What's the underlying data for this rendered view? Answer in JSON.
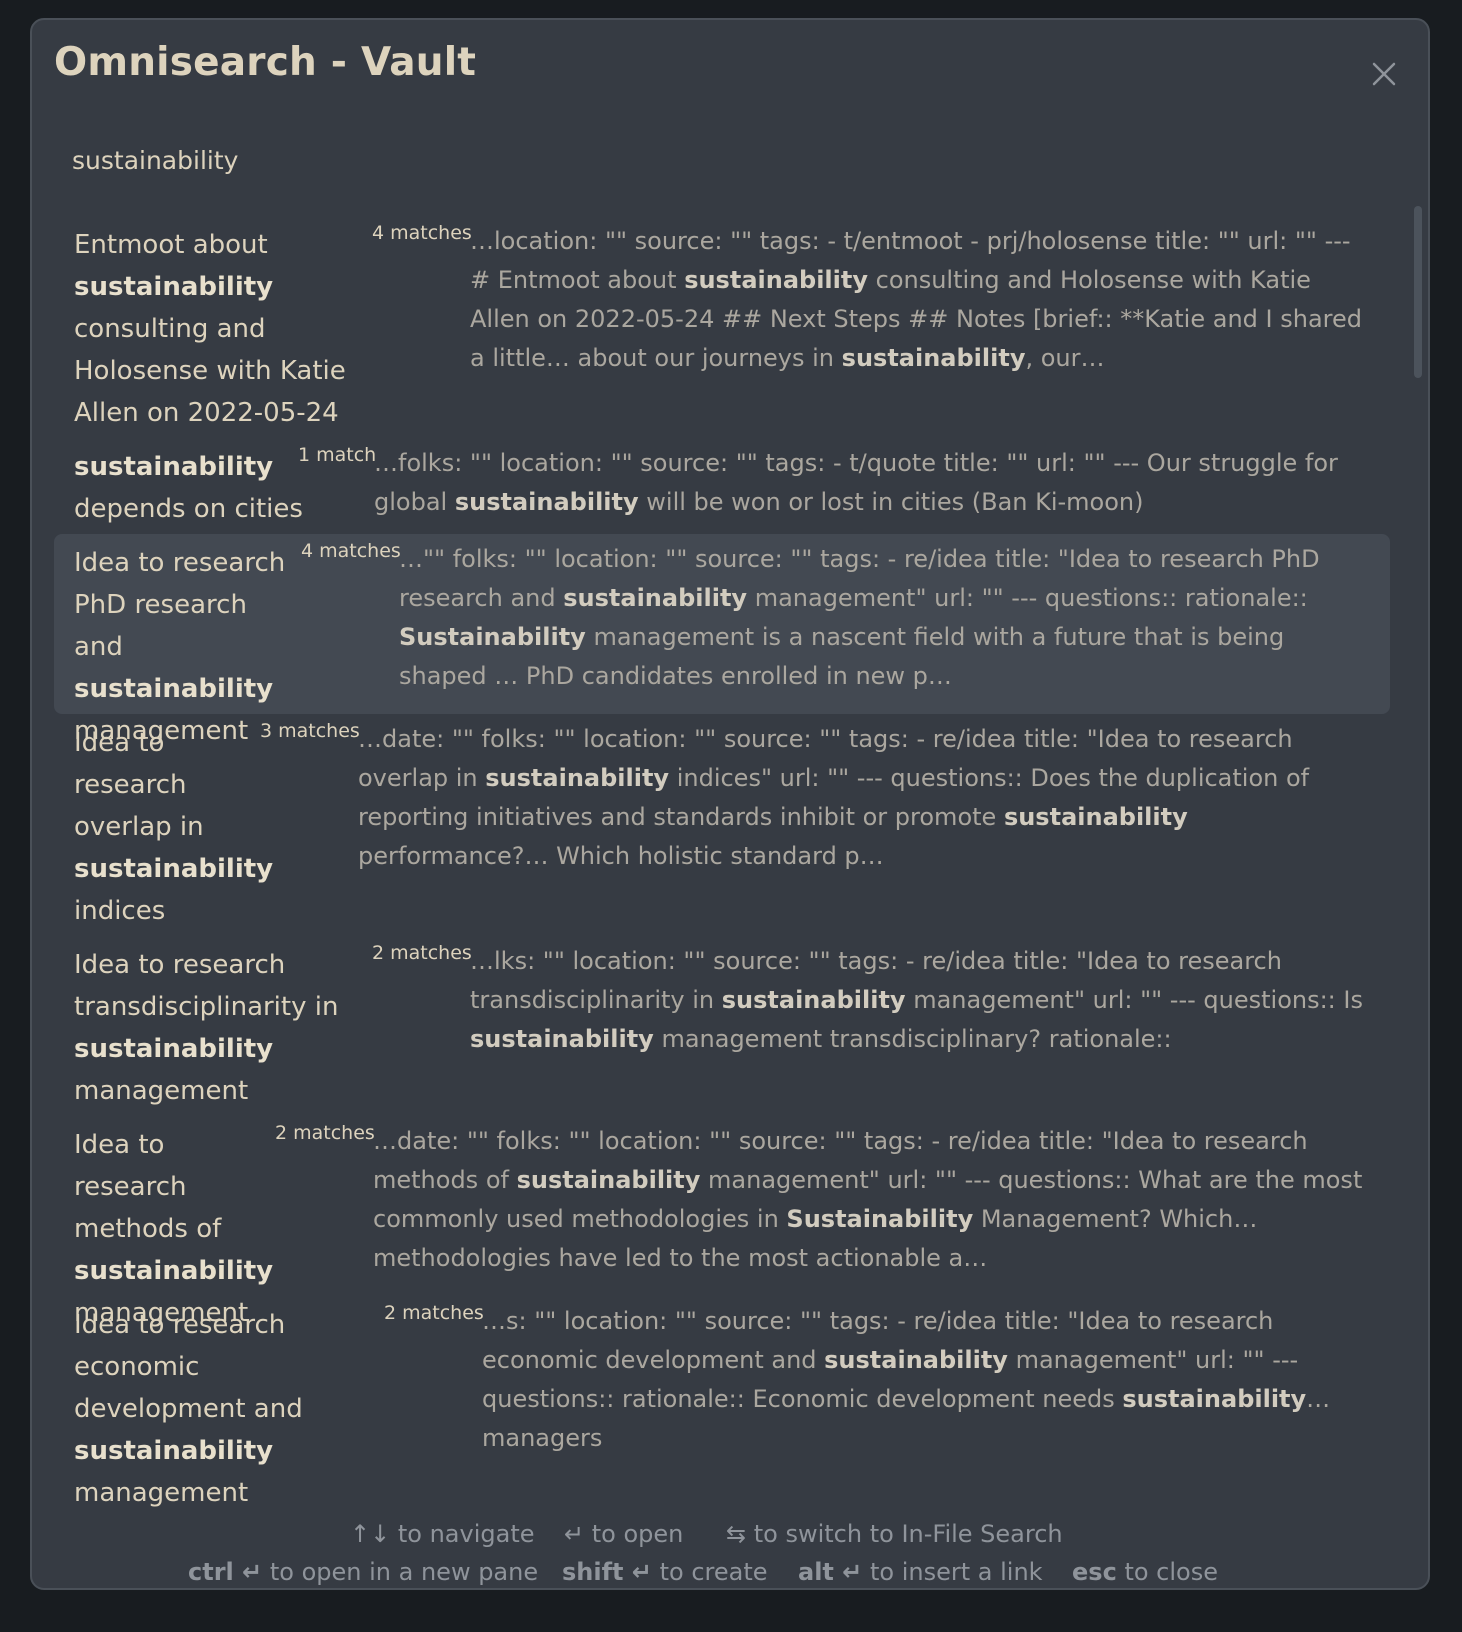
{
  "modal": {
    "title": "Omnisearch - Vault",
    "close_icon": "close-icon"
  },
  "search": {
    "value": "sustainability"
  },
  "results": [
    {
      "title_parts": [
        "Entmoot about ",
        "sustainability",
        " consulting and Holosense with Katie Allen on 2022-05-24"
      ],
      "matches": "4 matches",
      "excerpt_parts": [
        "…location: \"\" source: \"\" tags: - t/entmoot - prj/holosense title: \"\" url: \"\" --- # Entmoot about ",
        "sustainability",
        " consulting and Holosense with Katie Allen on 2022-05-24 ## Next Steps ## Notes [brief:: **Katie and I shared a little… about our journeys in ",
        "sustainability",
        ", our…"
      ]
    },
    {
      "title_parts": [
        "",
        "sustainability",
        " depends on cities"
      ],
      "matches": "1 match",
      "excerpt_parts": [
        "…folks: \"\" location: \"\" source: \"\" tags: - t/quote title: \"\" url: \"\" --- Our struggle for global ",
        "sustainability",
        " will be won or lost in cities (Ban Ki-moon)"
      ]
    },
    {
      "title_parts": [
        "Idea to research PhD research and ",
        "sustainability",
        " management"
      ],
      "matches": "4 matches",
      "excerpt_parts": [
        "…\"\" folks: \"\" location: \"\" source: \"\" tags: - re/idea title: \"Idea to research PhD research and ",
        "sustainability",
        " management\" url: \"\" --- questions:: rationale:: ",
        "Sustainability",
        " management is a nascent field with a future that is being shaped … PhD candidates enrolled in new p…"
      ]
    },
    {
      "title_parts": [
        "Idea to research overlap in ",
        "sustainability",
        " indices"
      ],
      "matches": "3 matches",
      "excerpt_parts": [
        "…date: \"\" folks: \"\" location: \"\" source: \"\" tags: - re/idea title: \"Idea to research overlap in ",
        "sustainability",
        " indices\" url: \"\" --- questions:: Does the duplication of reporting initiatives and standards inhibit or promote ",
        "sustainability",
        " performance?… Which holistic standard p…"
      ]
    },
    {
      "title_parts": [
        "Idea to research transdisciplinarity in ",
        "sustainability",
        " management"
      ],
      "matches": "2 matches",
      "excerpt_parts": [
        "…lks: \"\" location: \"\" source: \"\" tags: - re/idea title: \"Idea to research transdisciplinarity in ",
        "sustainability",
        " management\" url: \"\" --- questions:: Is ",
        "sustainability",
        " management transdisciplinary? rationale::"
      ]
    },
    {
      "title_parts": [
        "Idea to research methods of ",
        "sustainability",
        " management"
      ],
      "matches": "2 matches",
      "excerpt_parts": [
        "…date: \"\" folks: \"\" location: \"\" source: \"\" tags: - re/idea title: \"Idea to research methods of ",
        "sustainability",
        " management\" url: \"\" --- questions:: What are the most commonly used methodologies in ",
        "Sustainability",
        " Management? Which… methodologies have led to the most actionable a…"
      ]
    },
    {
      "title_parts": [
        "Idea to research economic development and ",
        "sustainability",
        " management"
      ],
      "matches": "2 matches",
      "excerpt_parts": [
        "…s: \"\" location: \"\" source: \"\" tags: - re/idea title: \"Idea to research economic development and ",
        "sustainability",
        " management\" url: \"\" --- questions:: rationale:: Economic development needs ",
        "sustainability",
        "… managers"
      ]
    }
  ],
  "footer": {
    "row1": [
      {
        "key": "↑↓",
        "text": "to navigate"
      },
      {
        "key": "↵",
        "text": "to open"
      },
      {
        "key": "⇆",
        "text": "to switch to In-File Search"
      }
    ],
    "row2": [
      {
        "key": "ctrl ↵",
        "text": "to open in a new pane"
      },
      {
        "key": "shift ↵",
        "text": "to create"
      },
      {
        "key": "alt ↵",
        "text": "to insert a link"
      },
      {
        "key": "esc",
        "text": "to close"
      }
    ]
  }
}
